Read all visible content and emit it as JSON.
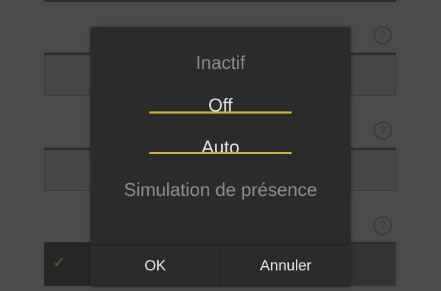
{
  "background": {
    "help_icon_glyph": "?",
    "check_glyph": "✓"
  },
  "dialog": {
    "options": [
      {
        "label": "Inactif",
        "selected": false
      },
      {
        "label": "Off",
        "selected": true
      },
      {
        "label": "Auto",
        "selected": true
      },
      {
        "label": "Simulation de présence",
        "selected": false
      }
    ],
    "ok_label": "OK",
    "cancel_label": "Annuler"
  },
  "colors": {
    "accent": "#cfae32",
    "dialog_bg": "#2b2b2b",
    "overlay_bg": "#4b4b4b"
  }
}
